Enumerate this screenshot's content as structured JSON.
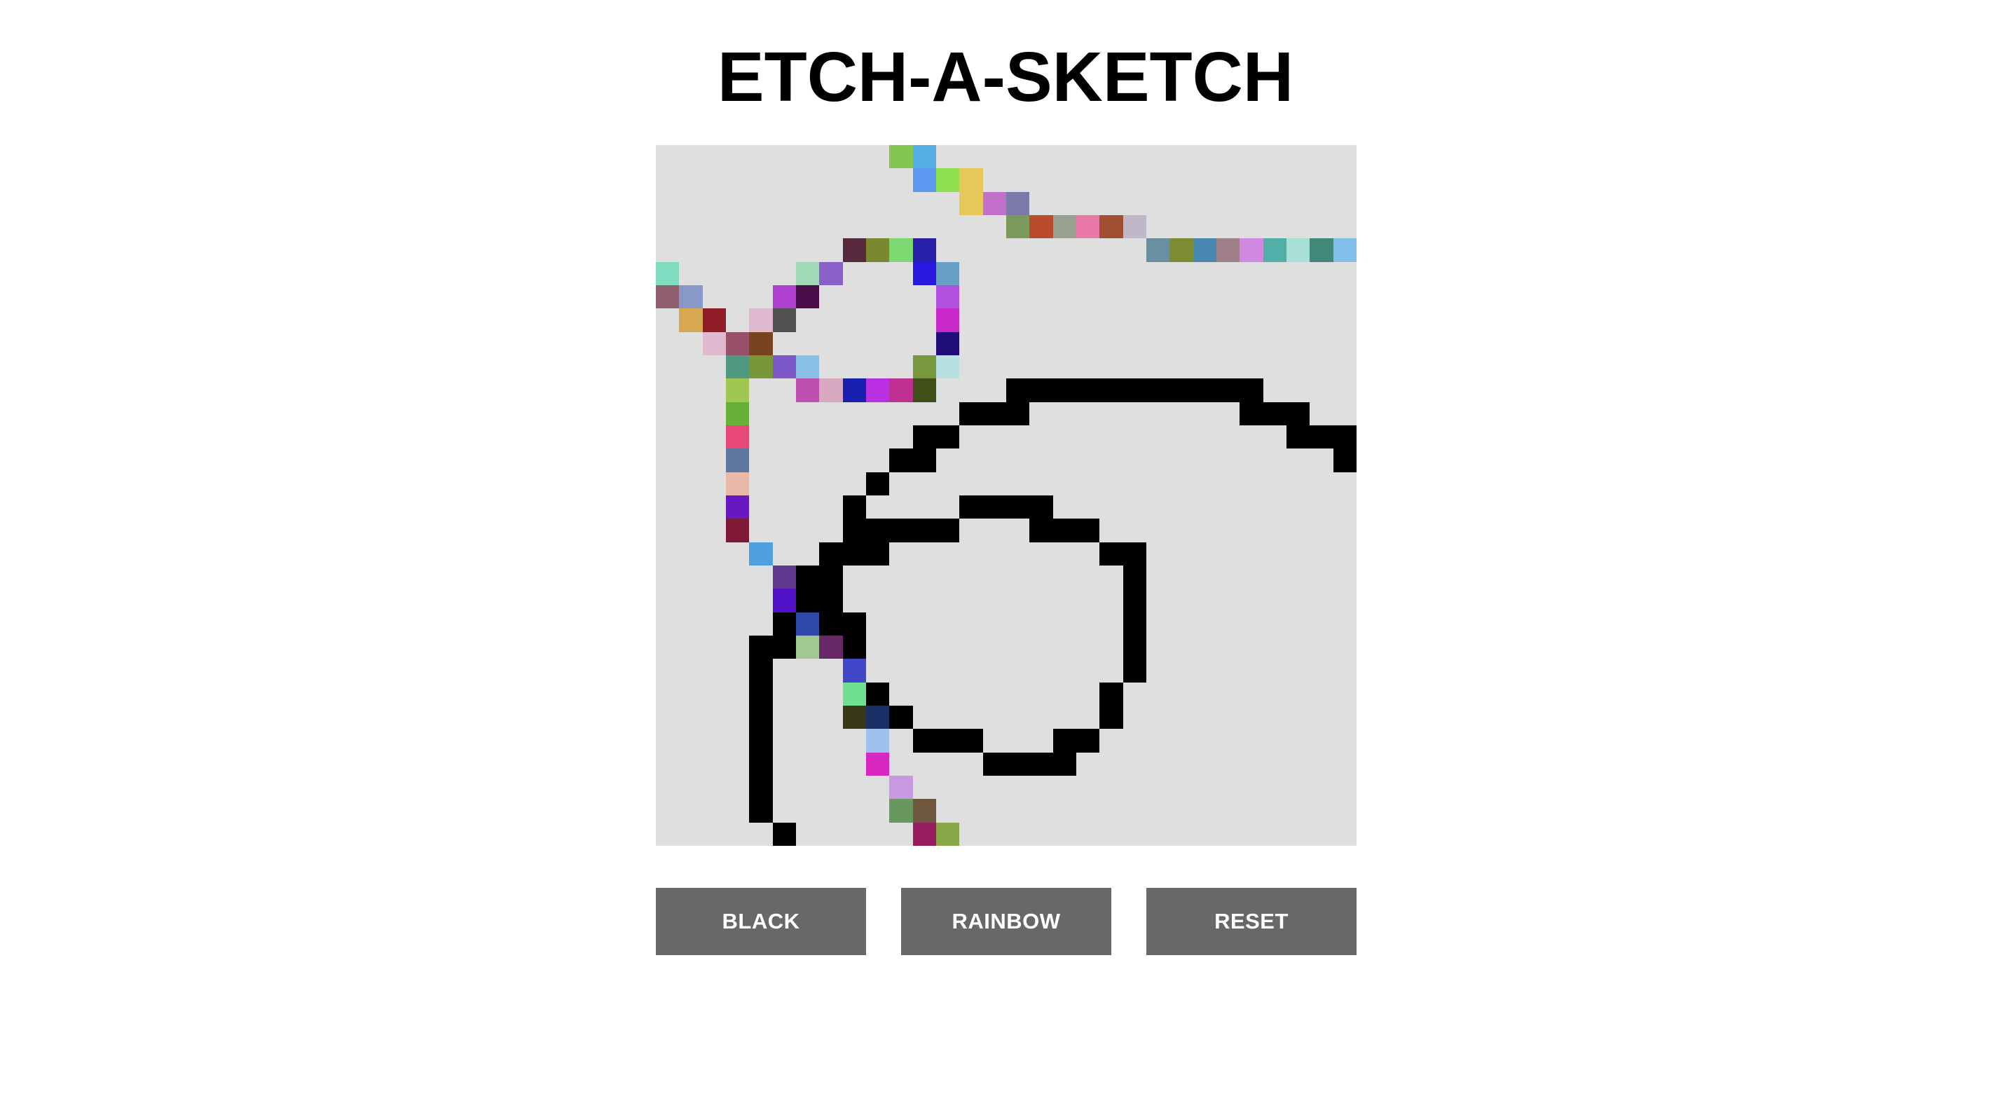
{
  "title": "ETCH-A-SKETCH",
  "buttons": {
    "black_label": "BLACK",
    "rainbow_label": "RAINBOW",
    "reset_label": "RESET"
  },
  "colors": {
    "grid_background": "#e0dfdf",
    "button_background": "#686868",
    "button_text": "#ffffff",
    "ink": "#000000"
  },
  "grid": {
    "size": 30,
    "painted": [
      [
        0,
        10,
        "#84c450"
      ],
      [
        0,
        11,
        "#56b0e6"
      ],
      [
        1,
        11,
        "#5b98f0"
      ],
      [
        1,
        12,
        "#8ee050"
      ],
      [
        1,
        13,
        "#e6c858"
      ],
      [
        2,
        13,
        "#e6c858"
      ],
      [
        2,
        14,
        "#c070c8"
      ],
      [
        2,
        15,
        "#7c78a8"
      ],
      [
        3,
        15,
        "#7c9a5c"
      ],
      [
        3,
        16,
        "#b84c2c"
      ],
      [
        3,
        17,
        "#98a090"
      ],
      [
        3,
        18,
        "#e878a8"
      ],
      [
        3,
        19,
        "#a05030"
      ],
      [
        3,
        20,
        "#c0b8c8"
      ],
      [
        4,
        8,
        "#58283c"
      ],
      [
        4,
        9,
        "#7c8830"
      ],
      [
        4,
        10,
        "#7cd870"
      ],
      [
        4,
        11,
        "#2820a8"
      ],
      [
        4,
        21,
        "#6890a0"
      ],
      [
        4,
        22,
        "#7c8c30"
      ],
      [
        4,
        23,
        "#4888b0"
      ],
      [
        4,
        24,
        "#a08088"
      ],
      [
        4,
        25,
        "#d088e0"
      ],
      [
        4,
        26,
        "#50b0a8"
      ],
      [
        4,
        27,
        "#a8e0d8"
      ],
      [
        4,
        28,
        "#408878"
      ],
      [
        4,
        29,
        "#80c0e8"
      ],
      [
        5,
        0,
        "#80dcc0"
      ],
      [
        5,
        6,
        "#a0d8b8"
      ],
      [
        5,
        7,
        "#8860c8"
      ],
      [
        5,
        11,
        "#2818e0"
      ],
      [
        5,
        12,
        "#68a0c8"
      ],
      [
        6,
        0,
        "#906070"
      ],
      [
        6,
        1,
        "#8898c8"
      ],
      [
        6,
        5,
        "#b040d0"
      ],
      [
        6,
        6,
        "#480c48"
      ],
      [
        6,
        12,
        "#b050e0"
      ],
      [
        7,
        1,
        "#d8a850"
      ],
      [
        7,
        2,
        "#901c28"
      ],
      [
        7,
        4,
        "#e0b8d0"
      ],
      [
        7,
        5,
        "#505050"
      ],
      [
        7,
        12,
        "#c828c8"
      ],
      [
        8,
        2,
        "#e0b8d0"
      ],
      [
        8,
        3,
        "#985068"
      ],
      [
        8,
        4,
        "#784420"
      ],
      [
        8,
        12,
        "#200c78"
      ],
      [
        9,
        3,
        "#509880"
      ],
      [
        9,
        4,
        "#789838"
      ],
      [
        9,
        5,
        "#7c58c8"
      ],
      [
        9,
        6,
        "#88c0e8"
      ],
      [
        9,
        11,
        "#789840"
      ],
      [
        9,
        12,
        "#b8e0e0"
      ],
      [
        10,
        3,
        "#a0c850"
      ],
      [
        10,
        6,
        "#c050b0"
      ],
      [
        10,
        7,
        "#d8a8c0"
      ],
      [
        10,
        8,
        "#1820b0"
      ],
      [
        10,
        9,
        "#b830e0"
      ],
      [
        10,
        10,
        "#c03090"
      ],
      [
        10,
        11,
        "#405018"
      ],
      [
        10,
        15,
        "#000000"
      ],
      [
        10,
        16,
        "#000000"
      ],
      [
        10,
        17,
        "#000000"
      ],
      [
        10,
        18,
        "#000000"
      ],
      [
        10,
        19,
        "#000000"
      ],
      [
        10,
        20,
        "#000000"
      ],
      [
        10,
        21,
        "#000000"
      ],
      [
        10,
        22,
        "#000000"
      ],
      [
        10,
        23,
        "#000000"
      ],
      [
        10,
        24,
        "#000000"
      ],
      [
        10,
        25,
        "#000000"
      ],
      [
        11,
        3,
        "#68b038"
      ],
      [
        11,
        13,
        "#000000"
      ],
      [
        11,
        14,
        "#000000"
      ],
      [
        11,
        15,
        "#000000"
      ],
      [
        11,
        25,
        "#000000"
      ],
      [
        11,
        26,
        "#000000"
      ],
      [
        11,
        27,
        "#000000"
      ],
      [
        12,
        3,
        "#e84878"
      ],
      [
        12,
        11,
        "#000000"
      ],
      [
        12,
        12,
        "#000000"
      ],
      [
        12,
        27,
        "#000000"
      ],
      [
        12,
        28,
        "#000000"
      ],
      [
        12,
        29,
        "#000000"
      ],
      [
        13,
        3,
        "#6078a0"
      ],
      [
        13,
        10,
        "#000000"
      ],
      [
        13,
        11,
        "#000000"
      ],
      [
        13,
        29,
        "#000000"
      ],
      [
        14,
        3,
        "#e8b8a8"
      ],
      [
        14,
        9,
        "#000000"
      ],
      [
        15,
        3,
        "#6818c0"
      ],
      [
        15,
        8,
        "#000000"
      ],
      [
        15,
        13,
        "#000000"
      ],
      [
        15,
        14,
        "#000000"
      ],
      [
        15,
        15,
        "#000000"
      ],
      [
        15,
        16,
        "#000000"
      ],
      [
        16,
        3,
        "#801838"
      ],
      [
        16,
        8,
        "#000000"
      ],
      [
        16,
        9,
        "#000000"
      ],
      [
        16,
        10,
        "#000000"
      ],
      [
        16,
        11,
        "#000000"
      ],
      [
        16,
        12,
        "#000000"
      ],
      [
        16,
        16,
        "#000000"
      ],
      [
        16,
        17,
        "#000000"
      ],
      [
        16,
        18,
        "#000000"
      ],
      [
        17,
        4,
        "#50a0e0"
      ],
      [
        17,
        7,
        "#000000"
      ],
      [
        17,
        8,
        "#000000"
      ],
      [
        17,
        9,
        "#000000"
      ],
      [
        17,
        19,
        "#000000"
      ],
      [
        17,
        20,
        "#000000"
      ],
      [
        18,
        5,
        "#603890"
      ],
      [
        18,
        6,
        "#000000"
      ],
      [
        18,
        7,
        "#000000"
      ],
      [
        18,
        20,
        "#000000"
      ],
      [
        19,
        5,
        "#5010c8"
      ],
      [
        19,
        6,
        "#000000"
      ],
      [
        19,
        7,
        "#000000"
      ],
      [
        19,
        20,
        "#000000"
      ],
      [
        20,
        5,
        "#000000"
      ],
      [
        20,
        6,
        "#3048a8"
      ],
      [
        20,
        7,
        "#000000"
      ],
      [
        20,
        8,
        "#000000"
      ],
      [
        20,
        20,
        "#000000"
      ],
      [
        21,
        4,
        "#000000"
      ],
      [
        21,
        5,
        "#000000"
      ],
      [
        21,
        6,
        "#a0c890"
      ],
      [
        21,
        7,
        "#682868"
      ],
      [
        21,
        8,
        "#000000"
      ],
      [
        21,
        20,
        "#000000"
      ],
      [
        22,
        4,
        "#000000"
      ],
      [
        22,
        8,
        "#4048c8"
      ],
      [
        22,
        20,
        "#000000"
      ],
      [
        23,
        4,
        "#000000"
      ],
      [
        23,
        8,
        "#70e090"
      ],
      [
        23,
        9,
        "#000000"
      ],
      [
        23,
        19,
        "#000000"
      ],
      [
        24,
        4,
        "#000000"
      ],
      [
        24,
        8,
        "#383818"
      ],
      [
        24,
        9,
        "#1c3068"
      ],
      [
        24,
        10,
        "#000000"
      ],
      [
        24,
        19,
        "#000000"
      ],
      [
        25,
        4,
        "#000000"
      ],
      [
        25,
        9,
        "#a0c0f0"
      ],
      [
        25,
        11,
        "#000000"
      ],
      [
        25,
        12,
        "#000000"
      ],
      [
        25,
        13,
        "#000000"
      ],
      [
        25,
        17,
        "#000000"
      ],
      [
        25,
        18,
        "#000000"
      ],
      [
        26,
        4,
        "#000000"
      ],
      [
        26,
        9,
        "#d828c0"
      ],
      [
        26,
        14,
        "#000000"
      ],
      [
        26,
        15,
        "#000000"
      ],
      [
        26,
        16,
        "#000000"
      ],
      [
        26,
        17,
        "#000000"
      ],
      [
        27,
        4,
        "#000000"
      ],
      [
        27,
        10,
        "#c898e0"
      ],
      [
        28,
        4,
        "#000000"
      ],
      [
        28,
        10,
        "#689860"
      ],
      [
        28,
        11,
        "#705840"
      ],
      [
        29,
        5,
        "#000000"
      ],
      [
        29,
        11,
        "#981c60"
      ],
      [
        29,
        12,
        "#88a848"
      ]
    ]
  }
}
